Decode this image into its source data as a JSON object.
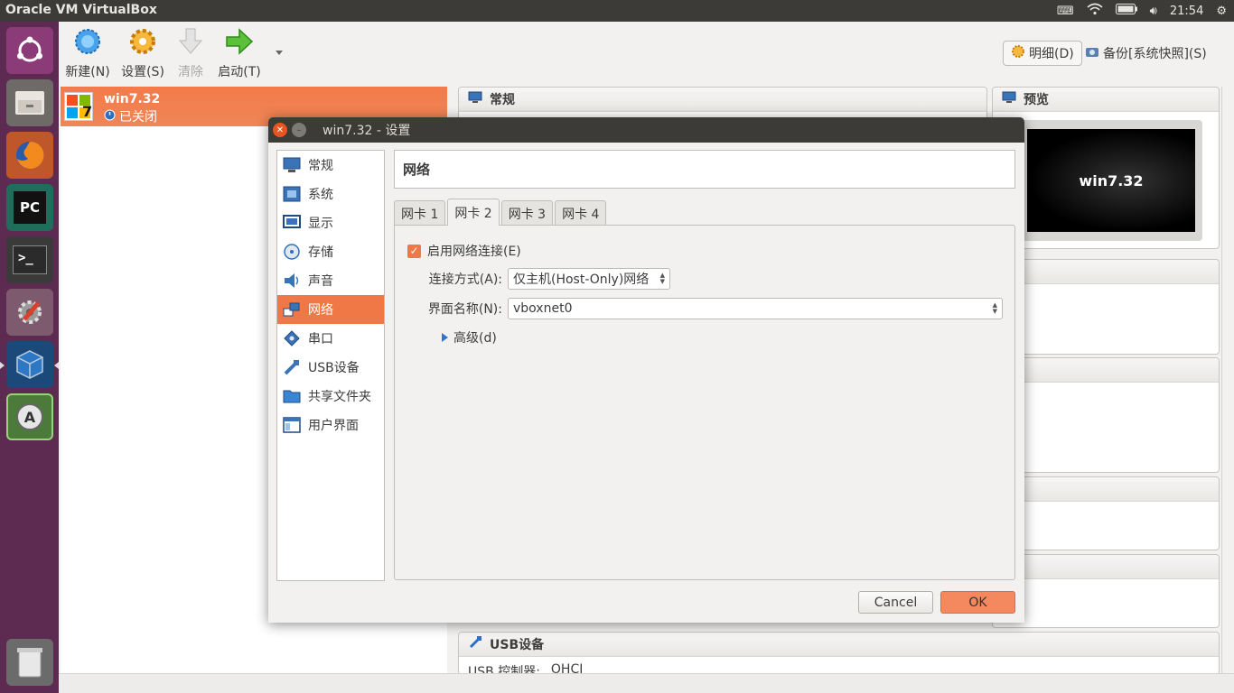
{
  "topbar": {
    "app_title": "Oracle VM VirtualBox",
    "time": "21:54"
  },
  "launcher": {
    "items": [
      "ubuntu-dash",
      "files",
      "firefox",
      "pycharm",
      "terminal",
      "system-settings",
      "virtualbox",
      "software-updater",
      "trash"
    ]
  },
  "toolbar": {
    "new_label": "新建(N)",
    "settings_label": "设置(S)",
    "discard_label": "清除",
    "start_label": "启动(T)",
    "details_label": "明细(D)",
    "snapshots_label": "备份[系统快照](S)"
  },
  "vm": {
    "name": "win7.32",
    "state": "已关闭"
  },
  "details": {
    "general_title": "常规",
    "preview_title": "预览",
    "preview_name": "win7.32",
    "usb_title": "USB设备",
    "usb_row_label": "USB 控制器:",
    "usb_row_value": "OHCI"
  },
  "dialog": {
    "title": "win7.32 - 设置",
    "page_title": "网络",
    "categories": [
      {
        "label": "常规",
        "icon": "general-icon"
      },
      {
        "label": "系统",
        "icon": "system-icon"
      },
      {
        "label": "显示",
        "icon": "display-icon"
      },
      {
        "label": "存储",
        "icon": "storage-icon"
      },
      {
        "label": "声音",
        "icon": "audio-icon"
      },
      {
        "label": "网络",
        "icon": "network-icon"
      },
      {
        "label": "串口",
        "icon": "serial-port-icon"
      },
      {
        "label": "USB设备",
        "icon": "usb-icon"
      },
      {
        "label": "共享文件夹",
        "icon": "shared-folder-icon"
      },
      {
        "label": "用户界面",
        "icon": "user-interface-icon"
      }
    ],
    "tabs": [
      "网卡 1",
      "网卡 2",
      "网卡 3",
      "网卡 4"
    ],
    "enable_label": "启用网络连接(E)",
    "enable_checked": true,
    "attached_label": "连接方式(A):",
    "attached_value": "仅主机(Host-Only)网络",
    "name_label": "界面名称(N):",
    "name_value": "vboxnet0",
    "advanced_label": "高级(d)",
    "cancel_label": "Cancel",
    "ok_label": "OK"
  },
  "colors": {
    "accent": "#f07746",
    "launcher": "#5d2a52",
    "titlebar": "#3c3b37"
  }
}
